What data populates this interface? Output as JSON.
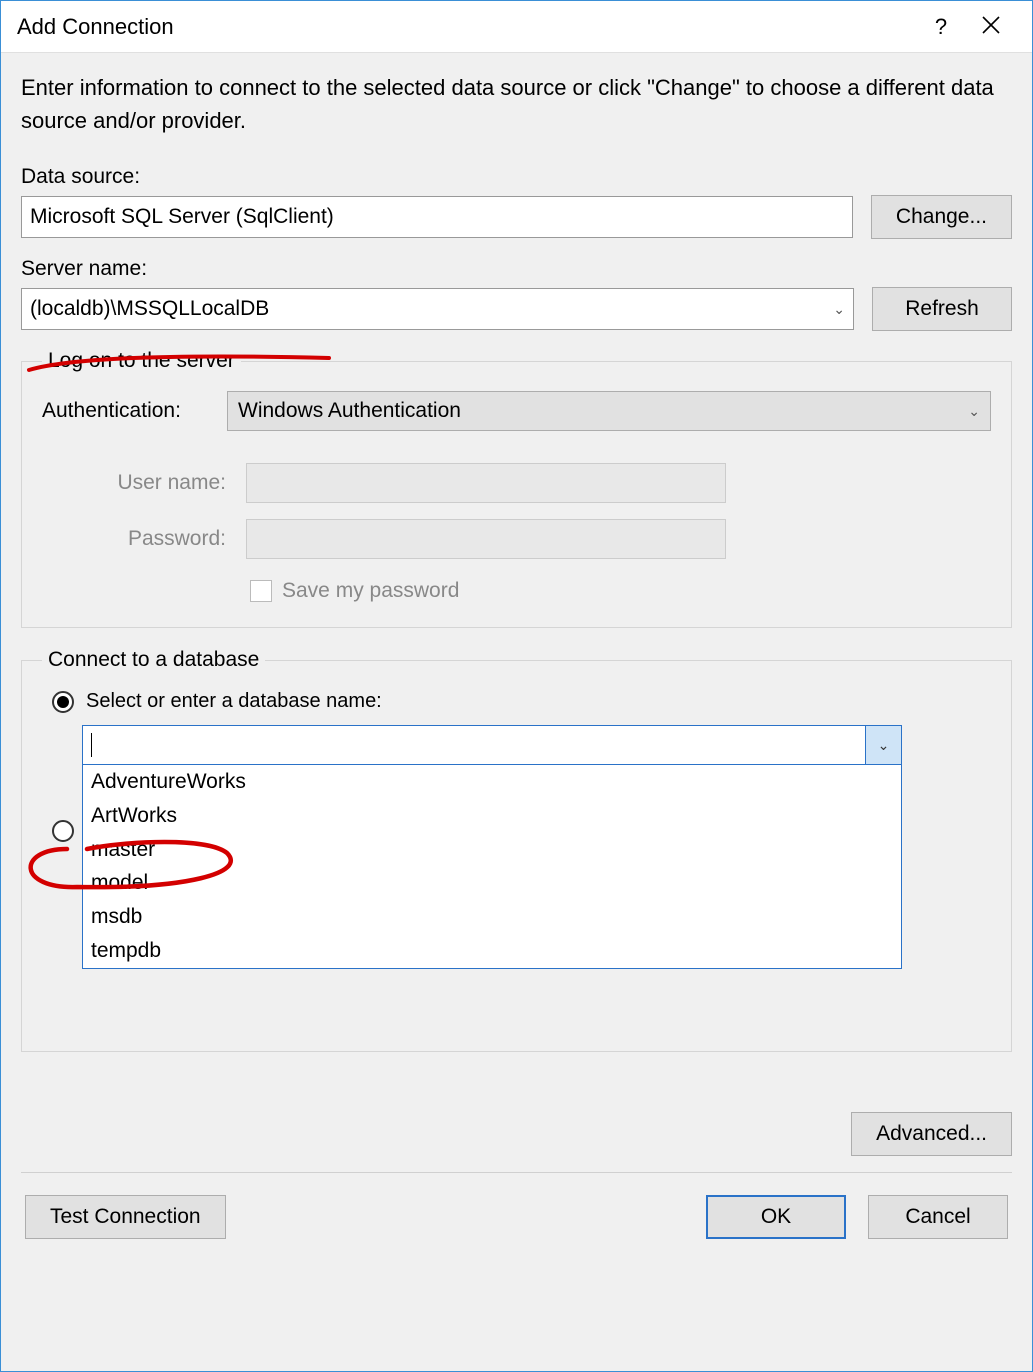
{
  "dialog": {
    "title": "Add Connection",
    "intro": "Enter information to connect to the selected data source or click \"Change\" to choose a different data source and/or provider."
  },
  "dataSource": {
    "label": "Data source:",
    "value": "Microsoft SQL Server (SqlClient)",
    "changeBtn": "Change..."
  },
  "server": {
    "label": "Server name:",
    "value": "(localdb)\\MSSQLLocalDB",
    "refreshBtn": "Refresh"
  },
  "logon": {
    "legend": "Log on to the server",
    "authLabel": "Authentication:",
    "authValue": "Windows Authentication",
    "userLabel": "User name:",
    "passLabel": "Password:",
    "savePassLabel": "Save my password"
  },
  "database": {
    "legend": "Connect to a database",
    "radioSelectLabel": "Select or enter a database name:",
    "selected": "",
    "options": [
      "AdventureWorks",
      "ArtWorks",
      "master",
      "model",
      "msdb",
      "tempdb"
    ]
  },
  "advancedBtn": "Advanced...",
  "footer": {
    "testBtn": "Test Connection",
    "okBtn": "OK",
    "cancelBtn": "Cancel"
  }
}
